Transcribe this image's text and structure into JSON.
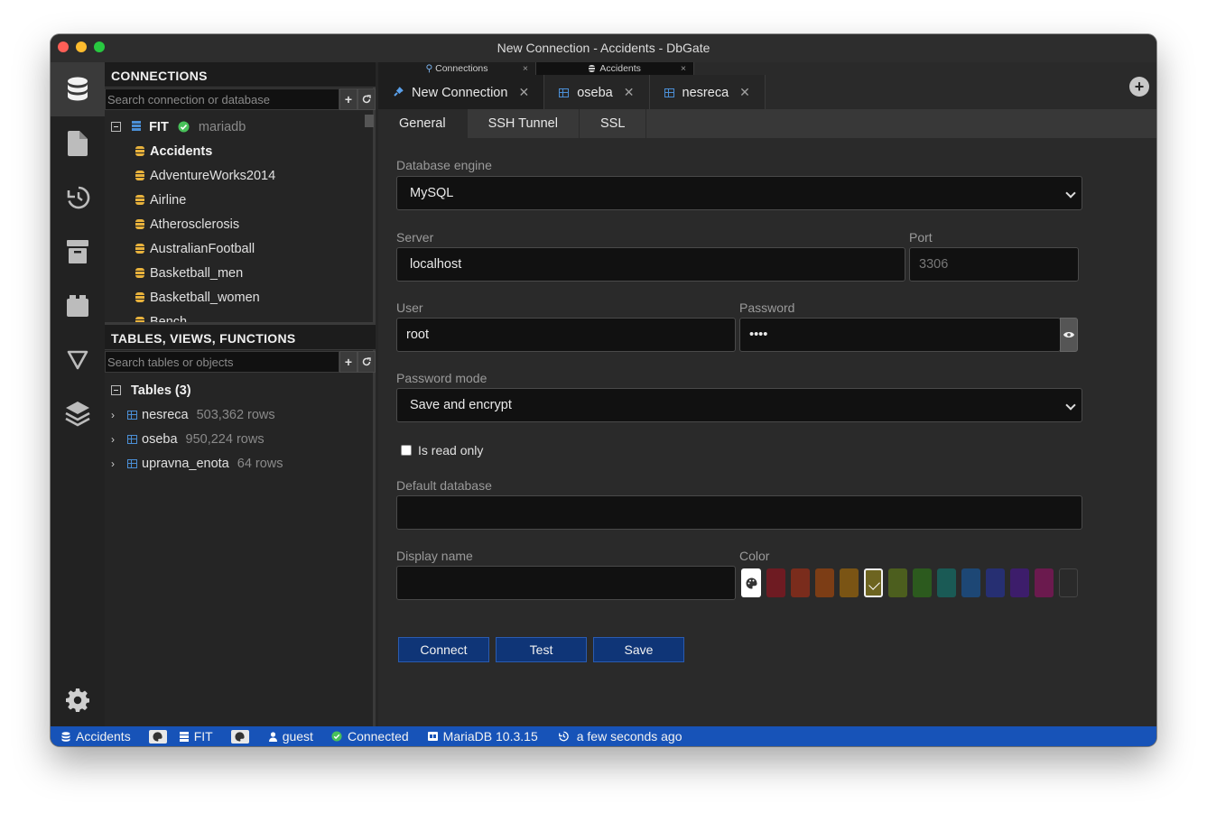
{
  "window": {
    "title": "New Connection - Accidents - DbGate"
  },
  "connections_panel": {
    "header": "CONNECTIONS",
    "search_placeholder": "Search connection or database",
    "server": {
      "name": "FIT",
      "engine": "mariadb"
    },
    "databases": [
      "Accidents",
      "AdventureWorks2014",
      "Airline",
      "Atherosclerosis",
      "AustralianFootball",
      "Basketball_men",
      "Basketball_women",
      "Bench"
    ]
  },
  "objects_panel": {
    "header": "TABLES, VIEWS, FUNCTIONS",
    "search_placeholder": "Search tables or objects",
    "group_label": "Tables (3)",
    "tables": [
      {
        "name": "nesreca",
        "rows": "503,362 rows"
      },
      {
        "name": "oseba",
        "rows": "950,224 rows"
      },
      {
        "name": "upravna_enota",
        "rows": "64 rows"
      }
    ]
  },
  "tab_groups": [
    {
      "label": "Connections"
    },
    {
      "label": "Accidents"
    }
  ],
  "doc_tabs": [
    {
      "label": "New Connection"
    },
    {
      "label": "oseba"
    },
    {
      "label": "nesreca"
    }
  ],
  "sub_tabs": [
    "General",
    "SSH Tunnel",
    "SSL"
  ],
  "form": {
    "engine_label": "Database engine",
    "engine_value": "MySQL",
    "server_label": "Server",
    "server_value": "localhost",
    "port_label": "Port",
    "port_placeholder": "3306",
    "user_label": "User",
    "user_value": "root",
    "password_label": "Password",
    "password_value": "••••",
    "password_mode_label": "Password mode",
    "password_mode_value": "Save and encrypt",
    "readonly_label": "Is read only",
    "default_db_label": "Default database",
    "display_name_label": "Display name",
    "color_label": "Color",
    "colors": [
      "#6e1b22",
      "#7a2c1c",
      "#7c3d15",
      "#7a5414",
      "#6d6420",
      "#4c5e1e",
      "#2c5a1e",
      "#1a5a55",
      "#1d4775",
      "#262f72",
      "#3d1d6b",
      "#6b1a4e",
      "#2a2a2a"
    ],
    "selected_color_index": 4,
    "connect_label": "Connect",
    "test_label": "Test",
    "save_label": "Save"
  },
  "statusbar": {
    "database": "Accidents",
    "server": "FIT",
    "user": "guest",
    "status": "Connected",
    "version": "MariaDB 10.3.15",
    "time": "a few seconds ago"
  }
}
